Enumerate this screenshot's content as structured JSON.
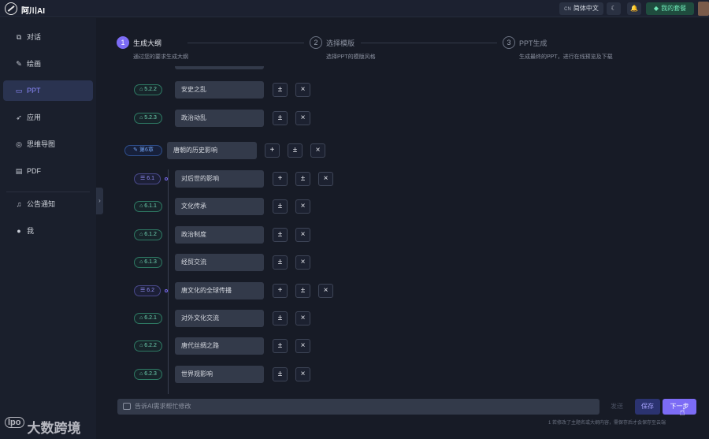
{
  "app": {
    "title": "阿川AI"
  },
  "topbar": {
    "lang_prefix": "CN",
    "lang_label": "简体中文",
    "moon_icon": "☾",
    "bell_icon": "🔔",
    "plan_label": "我的套餐",
    "plan_icon": "◆"
  },
  "sidebar": {
    "items": [
      {
        "label": "对话",
        "icon": "⧉"
      },
      {
        "label": "绘画",
        "icon": "✎"
      },
      {
        "label": "PPT",
        "icon": "▭"
      },
      {
        "label": "应用",
        "icon": "➶"
      },
      {
        "label": "思维导图",
        "icon": "◎"
      },
      {
        "label": "PDF",
        "icon": "▤"
      },
      {
        "label": "公告通知",
        "icon": "♫"
      },
      {
        "label": "我",
        "icon": "●"
      }
    ],
    "collapse_icon": "›"
  },
  "steps": [
    {
      "num": "1",
      "title": "生成大纲",
      "desc": "通过您的要求生成大纲"
    },
    {
      "num": "2",
      "title": "选择模版",
      "desc": "选择PPT的模版风格"
    },
    {
      "num": "3",
      "title": "PPT生成",
      "desc": "生成最终的PPT，进行在线预览及下载"
    }
  ],
  "outline": {
    "chapter": {
      "tag": "第6章",
      "title": "唐朝的历史影响"
    },
    "rows": [
      {
        "tag": "5.2.2",
        "title": "安史之乱",
        "kind": "item"
      },
      {
        "tag": "5.2.3",
        "title": "政治动乱",
        "kind": "item"
      },
      {
        "tag": "6.1",
        "title": "对后世的影响",
        "kind": "section"
      },
      {
        "tag": "6.1.1",
        "title": "文化传承",
        "kind": "item"
      },
      {
        "tag": "6.1.2",
        "title": "政治制度",
        "kind": "item"
      },
      {
        "tag": "6.1.3",
        "title": "经贸交流",
        "kind": "item"
      },
      {
        "tag": "6.2",
        "title": "唐文化的全球传播",
        "kind": "section"
      },
      {
        "tag": "6.2.1",
        "title": "对外文化交流",
        "kind": "item"
      },
      {
        "tag": "6.2.2",
        "title": "唐代丝绸之路",
        "kind": "item"
      },
      {
        "tag": "6.2.3",
        "title": "世界观影响",
        "kind": "item"
      }
    ],
    "add_glyph": "+",
    "insert_glyph": "±",
    "delete_glyph": "×"
  },
  "footer": {
    "input_placeholder": "告诉AI需求帮忙修改",
    "send_label": "发送",
    "save_label": "保存",
    "next_label": "下一步",
    "hint": "1 若修改了主题名或大纲内容，需保存后才会保存至云端"
  },
  "watermark": {
    "logo": "lpo",
    "text": "大数跨境"
  },
  "colors": {
    "accent": "#7c6cf5",
    "green_tag": "#6fd3b2",
    "background": "#171b26"
  }
}
